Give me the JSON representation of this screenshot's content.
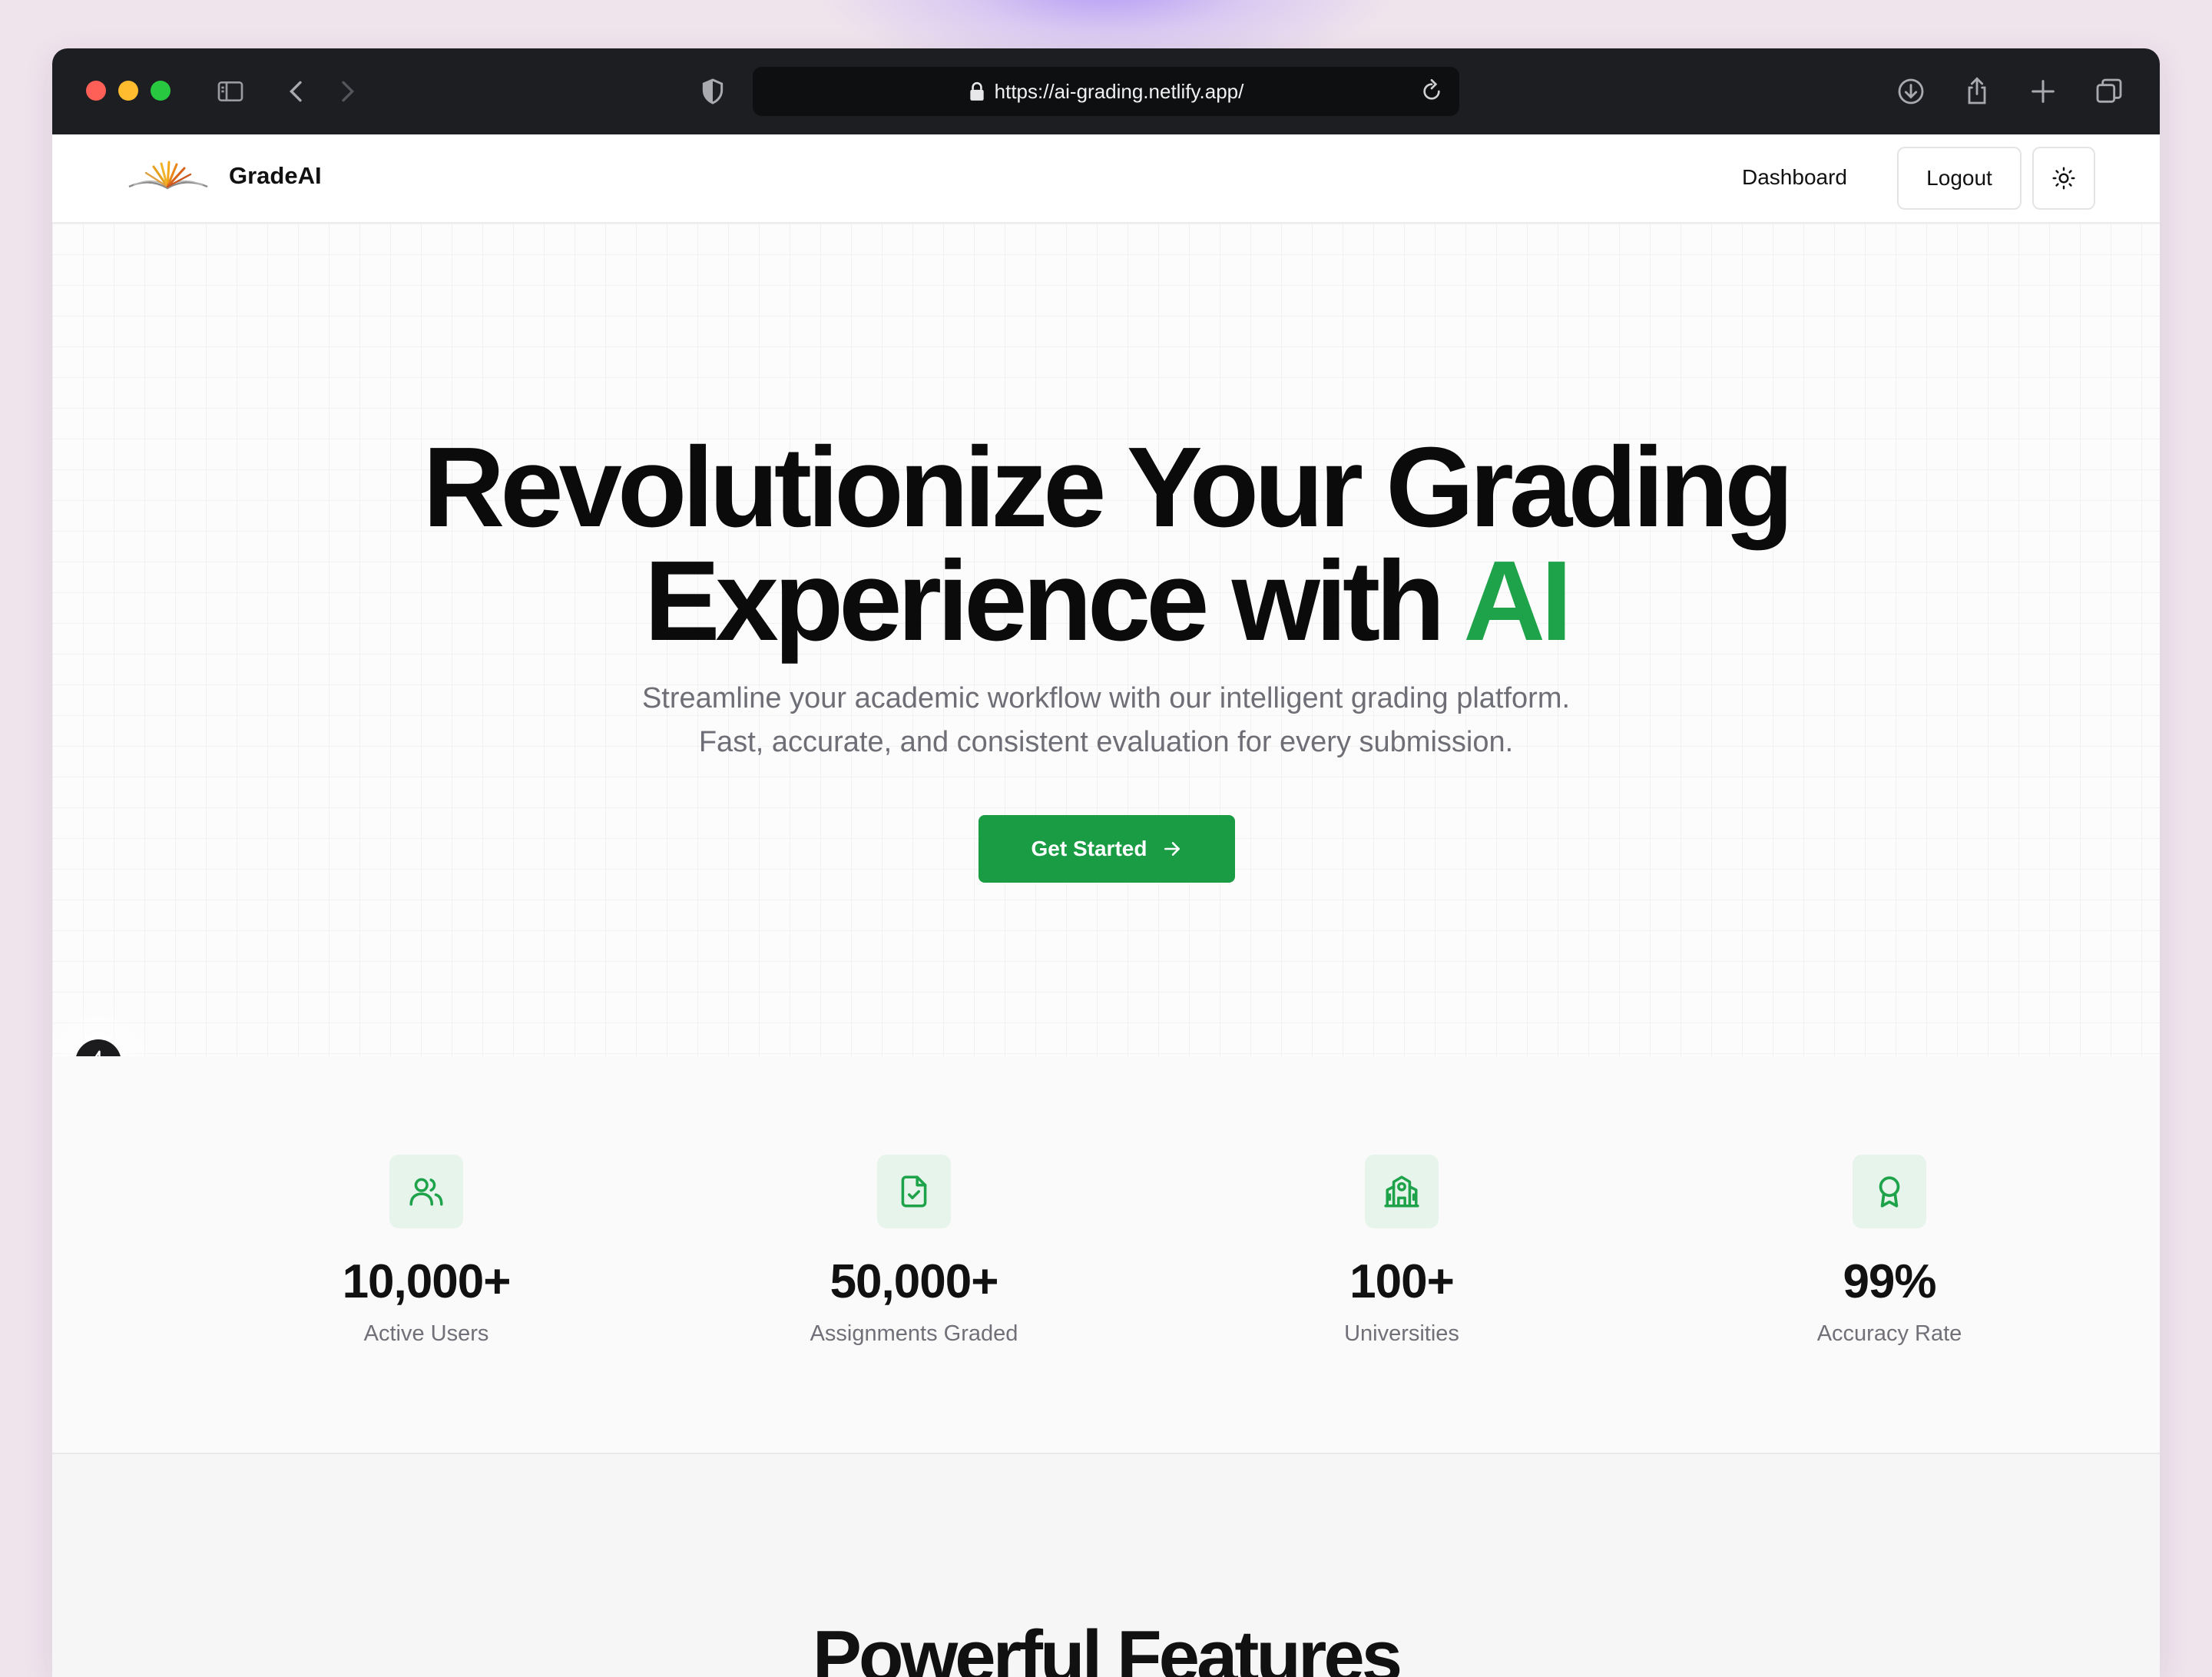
{
  "browser": {
    "url": "https://ai-grading.netlify.app/"
  },
  "navbar": {
    "brand": "GradeAI",
    "dashboard_label": "Dashboard",
    "logout_label": "Logout"
  },
  "hero": {
    "title_line1": "Revolutionize Your Grading",
    "title_line2_prefix": "Experience with ",
    "title_accent": "AI",
    "subtitle_line1": "Streamline your academic workflow with our intelligent grading platform.",
    "subtitle_line2": "Fast, accurate, and consistent evaluation for every submission.",
    "cta_label": "Get Started"
  },
  "stats": [
    {
      "value": "10,000+",
      "label": "Active Users",
      "icon": "users-icon"
    },
    {
      "value": "50,000+",
      "label": "Assignments Graded",
      "icon": "file-check-icon"
    },
    {
      "value": "100+",
      "label": "Universities",
      "icon": "school-icon"
    },
    {
      "value": "99%",
      "label": "Accuracy Rate",
      "icon": "award-icon"
    }
  ],
  "features": {
    "title": "Powerful Features"
  },
  "colors": {
    "accent": "#1fa34a",
    "button": "#1a9c45",
    "icon_bg": "#e7f4ec"
  }
}
